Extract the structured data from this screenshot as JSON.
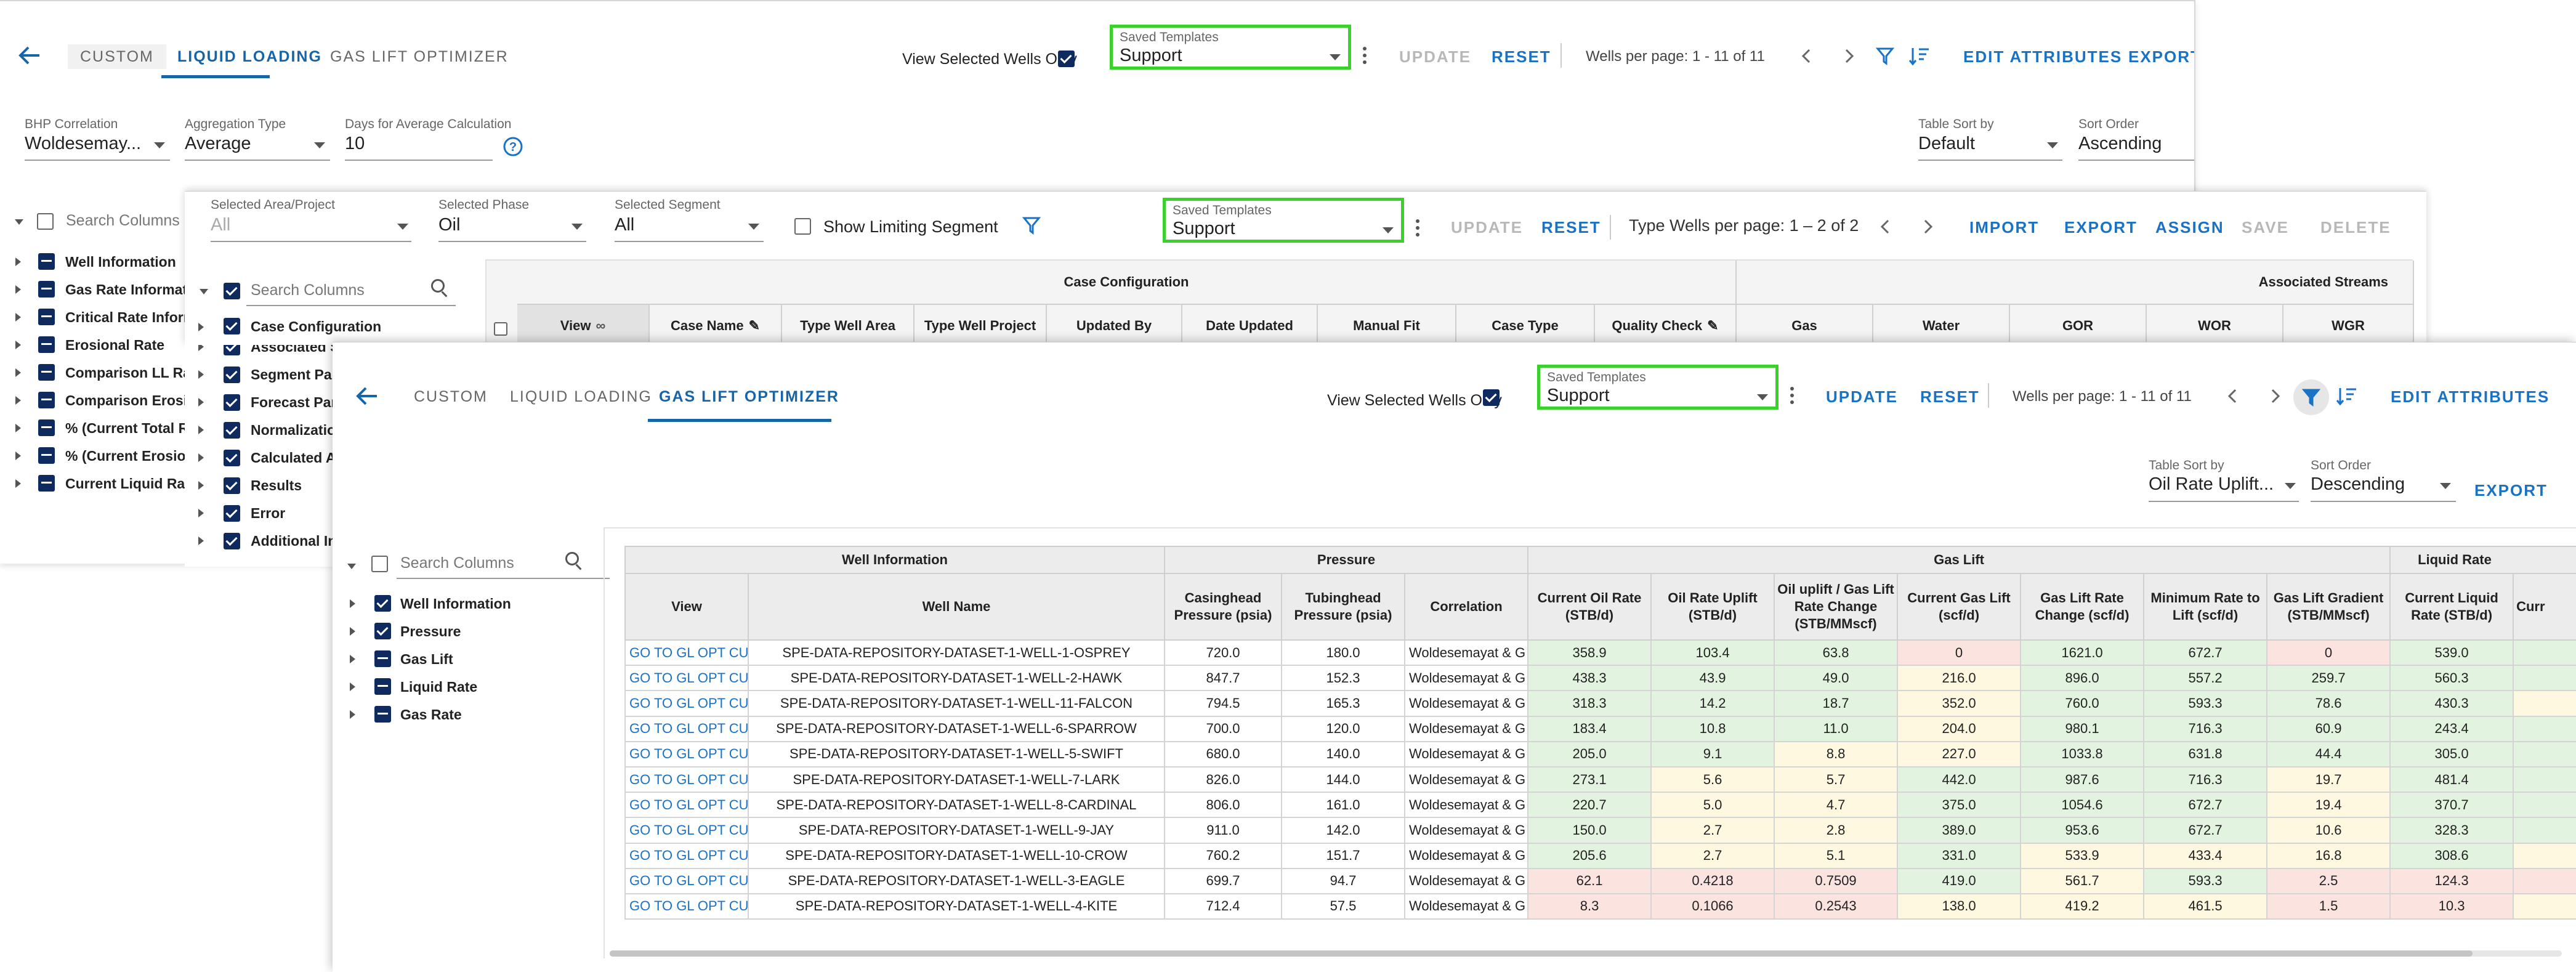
{
  "p1": {
    "tabs": [
      "CUSTOM",
      "LIQUID LOADING",
      "GAS LIFT OPTIMIZER"
    ],
    "view_selected": "View Selected Wells Only",
    "template_label": "Saved Templates",
    "template_value": "Support",
    "update": "UPDATE",
    "reset": "RESET",
    "wells_per_page": "Wells per page: 1 - 11 of 11",
    "edit_attributes": "EDIT ATTRIBUTES",
    "export": "EXPORT",
    "bhp_label": "BHP Correlation",
    "bhp_value": "Woldesemay...",
    "agg_label": "Aggregation Type",
    "agg_value": "Average",
    "days_label": "Days for Average Calculation",
    "days_value": "10",
    "sort_label": "Table Sort by",
    "sort_value": "Default",
    "order_label": "Sort Order",
    "order_value": "Ascending",
    "search_placeholder": "Search Columns",
    "tree": [
      "Well Information",
      "Gas Rate Informati",
      "Critical Rate Inform",
      "Erosional Rate",
      "Comparison LL Rat",
      "Comparison Erosio",
      "% (Current Total Ra",
      "% (Current Erosiona",
      "Current Liquid Rate"
    ]
  },
  "p2": {
    "area_label": "Selected Area/Project",
    "area_value": "All",
    "phase_label": "Selected Phase",
    "phase_value": "Oil",
    "segment_label": "Selected Segment",
    "segment_value": "All",
    "limiting": "Show Limiting Segment",
    "template_label": "Saved Templates",
    "template_value": "Support",
    "update": "UPDATE",
    "reset": "RESET",
    "type_wells": "Type Wells per page: 1 – 2 of 2",
    "import": "IMPORT",
    "export": "EXPORT",
    "assign": "ASSIGN",
    "save": "SAVE",
    "delete": "DELETE",
    "search_placeholder": "Search Columns",
    "tree": [
      "Case Configuration",
      "Associated St",
      "Segment Para",
      "Forecast Para",
      "Normalizatior",
      "Calculated At",
      "Results",
      "Error",
      "Additional Inf"
    ],
    "group_case": "Case Configuration",
    "group_streams": "Associated Streams",
    "cols": [
      "View",
      "Case Name",
      "Type Well Area",
      "Type Well Project",
      "Updated By",
      "Date Updated",
      "Manual Fit",
      "Case Type",
      "Quality Check",
      "Gas",
      "Water",
      "GOR",
      "WOR",
      "WGR"
    ]
  },
  "p3": {
    "tabs": [
      "CUSTOM",
      "LIQUID LOADING",
      "GAS LIFT OPTIMIZER"
    ],
    "view_selected": "View Selected Wells Only",
    "template_label": "Saved Templates",
    "template_value": "Support",
    "update": "UPDATE",
    "reset": "RESET",
    "wells_per_page": "Wells per page: 1 - 11 of 11",
    "edit_attributes": "EDIT ATTRIBUTES",
    "export": "EXPORT",
    "sort_label": "Table Sort by",
    "sort_value": "Oil Rate Uplift...",
    "order_label": "Sort Order",
    "order_value": "Descending",
    "search_placeholder": "Search Columns",
    "tree": [
      "Well Information",
      "Pressure",
      "Gas Lift",
      "Liquid Rate",
      "Gas Rate"
    ],
    "groups": [
      "Well Information",
      "Pressure",
      "Gas Lift",
      "Liquid Rate"
    ],
    "cols": [
      "View",
      "Well Name",
      "Casinghead Pressure (psia)",
      "Tubinghead Pressure (psia)",
      "Correlation",
      "Current Oil Rate (STB/d)",
      "Oil Rate Uplift (STB/d)",
      "Oil uplift / Gas Lift Rate Change (STB/MMscf)",
      "Current Gas Lift (scf/d)",
      "Gas Lift Rate Change (scf/d)",
      "Minimum Rate to Lift (scf/d)",
      "Gas Lift Gradient (STB/MMscf)",
      "Current Liquid Rate (STB/d)",
      "Curr"
    ],
    "rows": [
      [
        "GO TO GL OPT CUR",
        "SPE-DATA-REPOSITORY-DATASET-1-WELL-1-OSPREY",
        "720.0",
        "180.0",
        "Woldesemayat & G",
        "358.9",
        "103.4",
        "63.8",
        "0",
        "1621.0",
        "672.7",
        "0",
        "539.0"
      ],
      [
        "GO TO GL OPT CUR",
        "SPE-DATA-REPOSITORY-DATASET-1-WELL-2-HAWK",
        "847.7",
        "152.3",
        "Woldesemayat & G",
        "438.3",
        "43.9",
        "49.0",
        "216.0",
        "896.0",
        "557.2",
        "259.7",
        "560.3"
      ],
      [
        "GO TO GL OPT CUR",
        "SPE-DATA-REPOSITORY-DATASET-1-WELL-11-FALCON",
        "794.5",
        "165.3",
        "Woldesemayat & G",
        "318.3",
        "14.2",
        "18.7",
        "352.0",
        "760.0",
        "593.3",
        "78.6",
        "430.3"
      ],
      [
        "GO TO GL OPT CUR",
        "SPE-DATA-REPOSITORY-DATASET-1-WELL-6-SPARROW",
        "700.0",
        "120.0",
        "Woldesemayat & G",
        "183.4",
        "10.8",
        "11.0",
        "204.0",
        "980.1",
        "716.3",
        "60.9",
        "243.4"
      ],
      [
        "GO TO GL OPT CUR",
        "SPE-DATA-REPOSITORY-DATASET-1-WELL-5-SWIFT",
        "680.0",
        "140.0",
        "Woldesemayat & G",
        "205.0",
        "9.1",
        "8.8",
        "227.0",
        "1033.8",
        "631.8",
        "44.4",
        "305.0"
      ],
      [
        "GO TO GL OPT CUR",
        "SPE-DATA-REPOSITORY-DATASET-1-WELL-7-LARK",
        "826.0",
        "144.0",
        "Woldesemayat & G",
        "273.1",
        "5.6",
        "5.7",
        "442.0",
        "987.6",
        "716.3",
        "19.7",
        "481.4"
      ],
      [
        "GO TO GL OPT CUR",
        "SPE-DATA-REPOSITORY-DATASET-1-WELL-8-CARDINAL",
        "806.0",
        "161.0",
        "Woldesemayat & G",
        "220.7",
        "5.0",
        "4.7",
        "375.0",
        "1054.6",
        "672.7",
        "19.4",
        "370.7"
      ],
      [
        "GO TO GL OPT CUR",
        "SPE-DATA-REPOSITORY-DATASET-1-WELL-9-JAY",
        "911.0",
        "142.0",
        "Woldesemayat & G",
        "150.0",
        "2.7",
        "2.8",
        "389.0",
        "953.6",
        "672.7",
        "10.6",
        "328.3"
      ],
      [
        "GO TO GL OPT CUR",
        "SPE-DATA-REPOSITORY-DATASET-1-WELL-10-CROW",
        "760.2",
        "151.7",
        "Woldesemayat & G",
        "205.6",
        "2.7",
        "5.1",
        "331.0",
        "533.9",
        "433.4",
        "16.8",
        "308.6"
      ],
      [
        "GO TO GL OPT CUR",
        "SPE-DATA-REPOSITORY-DATASET-1-WELL-3-EAGLE",
        "699.7",
        "94.7",
        "Woldesemayat & G",
        "62.1",
        "0.4218",
        "0.7509",
        "419.0",
        "561.7",
        "593.3",
        "2.5",
        "124.3"
      ],
      [
        "GO TO GL OPT CUR",
        "SPE-DATA-REPOSITORY-DATASET-1-WELL-4-KITE",
        "712.4",
        "57.5",
        "Woldesemayat & G",
        "8.3",
        "0.1066",
        "0.2543",
        "138.0",
        "419.2",
        "461.5",
        "1.5",
        "10.3"
      ]
    ],
    "row_colors": [
      [
        "",
        "",
        "",
        "",
        "",
        "g",
        "g",
        "g",
        "r",
        "g",
        "g",
        "r",
        "g",
        "g"
      ],
      [
        "",
        "",
        "",
        "",
        "",
        "g",
        "g",
        "g",
        "y",
        "g",
        "g",
        "g",
        "g",
        "g"
      ],
      [
        "",
        "",
        "",
        "",
        "",
        "g",
        "g",
        "g",
        "y",
        "g",
        "g",
        "g",
        "g",
        "y"
      ],
      [
        "",
        "",
        "",
        "",
        "",
        "g",
        "g",
        "g",
        "y",
        "g",
        "g",
        "g",
        "g",
        "g"
      ],
      [
        "",
        "",
        "",
        "",
        "",
        "g",
        "g",
        "y",
        "y",
        "g",
        "g",
        "g",
        "g",
        "g"
      ],
      [
        "",
        "",
        "",
        "",
        "",
        "g",
        "y",
        "y",
        "g",
        "g",
        "g",
        "y",
        "g",
        "g"
      ],
      [
        "",
        "",
        "",
        "",
        "",
        "g",
        "y",
        "y",
        "g",
        "g",
        "g",
        "y",
        "g",
        "g"
      ],
      [
        "",
        "",
        "",
        "",
        "",
        "g",
        "y",
        "y",
        "g",
        "g",
        "g",
        "y",
        "g",
        "g"
      ],
      [
        "",
        "",
        "",
        "",
        "",
        "g",
        "y",
        "y",
        "g",
        "y",
        "y",
        "y",
        "g",
        "y"
      ],
      [
        "",
        "",
        "",
        "",
        "",
        "r",
        "r",
        "r",
        "g",
        "y",
        "g",
        "r",
        "r",
        "r"
      ],
      [
        "",
        "",
        "",
        "",
        "",
        "r",
        "r",
        "r",
        "y",
        "y",
        "y",
        "r",
        "r",
        "y"
      ]
    ]
  }
}
